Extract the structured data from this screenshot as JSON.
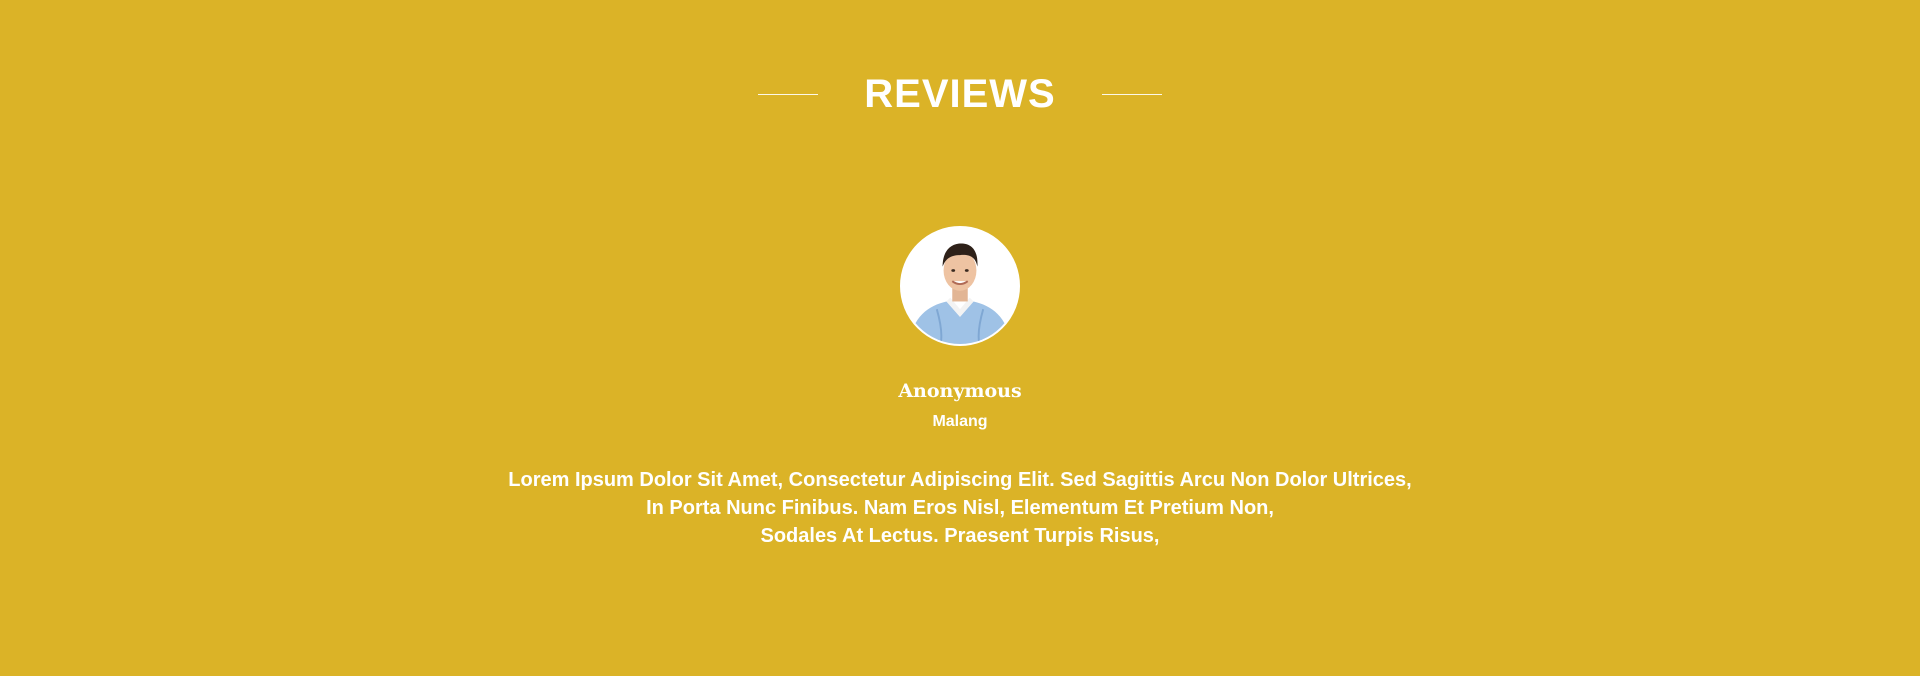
{
  "section": {
    "title": "REVIEWS",
    "background_color": "#dbb327",
    "text_color": "#ffffff"
  },
  "review": {
    "avatar": "reviewer-photo",
    "name": "Anonymous",
    "location": "Malang",
    "text_lines": [
      "Lorem Ipsum Dolor Sit Amet, Consectetur Adipiscing Elit. Sed Sagittis Arcu Non Dolor Ultrices,",
      "In Porta Nunc Finibus. Nam Eros Nisl, Elementum Et Pretium Non,",
      "Sodales At Lectus. Praesent Turpis Risus,"
    ]
  }
}
